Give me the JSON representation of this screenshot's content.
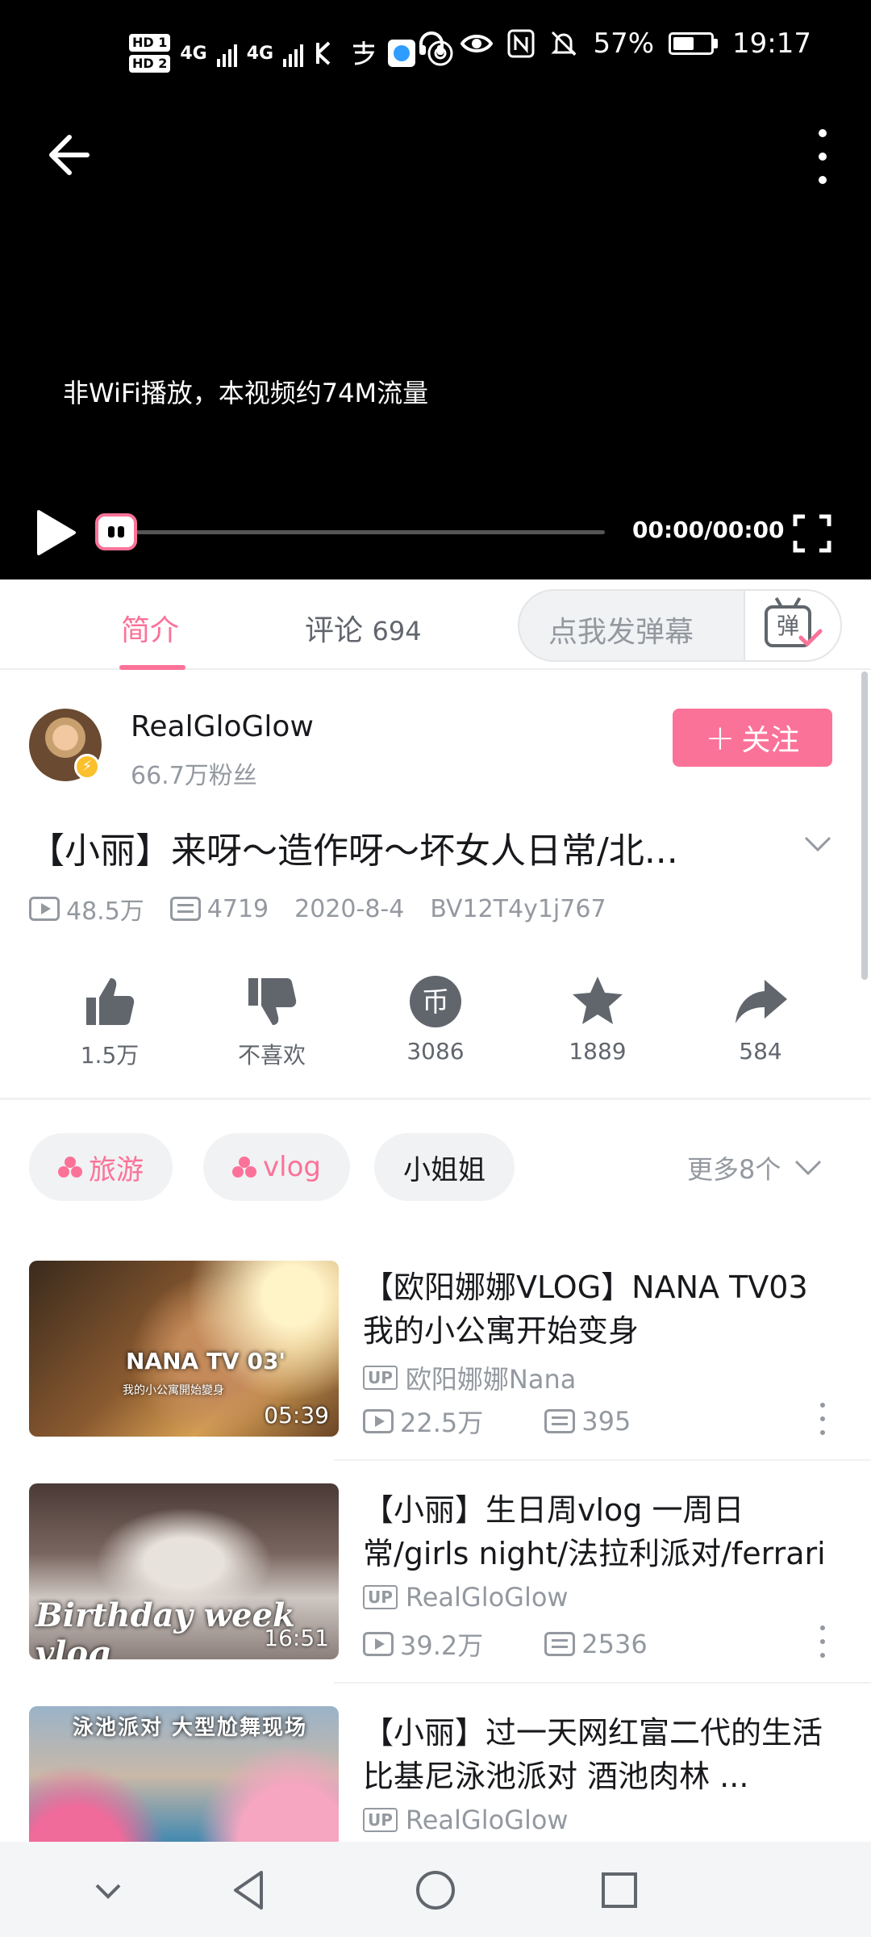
{
  "status_bar": {
    "hd1": "HD 1",
    "hd2": "HD 2",
    "net1": "4G",
    "net2": "4G",
    "battery_percent": "57%",
    "battery_level": 0.57,
    "time": "19:17"
  },
  "player": {
    "flow_notice": "非WiFi播放，本视频约74M流量",
    "time_label": "00:00/00:00",
    "progress": 0
  },
  "tabs": {
    "intro_label": "简介",
    "comments_label": "评论",
    "comments_count": "694",
    "danmaku_placeholder": "点我发弹幕",
    "danmaku_icon_char": "弹"
  },
  "uploader": {
    "name": "RealGloGlow",
    "fans": "66.7万粉丝",
    "follow_label": "关注",
    "follow_plus": "+"
  },
  "video": {
    "title": "【小丽】来呀～造作呀～坏女人日常/北...",
    "views": "48.5万",
    "danmaku": "4719",
    "date": "2020-8-4",
    "bvid": "BV12T4y1j767"
  },
  "actions": [
    {
      "label": "1.5万",
      "icon": "like-icon"
    },
    {
      "label": "不喜欢",
      "icon": "dislike-icon"
    },
    {
      "label": "3086",
      "icon": "coin-icon",
      "coin_char": "币"
    },
    {
      "label": "1889",
      "icon": "star-icon"
    },
    {
      "label": "584",
      "icon": "share-icon"
    }
  ],
  "tags": {
    "items": [
      "旅游",
      "vlog",
      "小姐姐"
    ],
    "more": "更多8个"
  },
  "recommendations": [
    {
      "title": "【欧阳娜娜VLOG】NANA TV03 我的小公寓开始变身",
      "up_badge": "UP",
      "up": "欧阳娜娜Nana",
      "views": "22.5万",
      "danmaku": "395",
      "duration": "05:39",
      "thumb_text": "NANA TV 03'",
      "thumb_sub": "我的小公寓開始變身"
    },
    {
      "title": "【小丽】生日周vlog 一周日常/girls night/法拉利派对/ferrari r...",
      "up_badge": "UP",
      "up": "RealGloGlow",
      "views": "39.2万",
      "danmaku": "2536",
      "duration": "16:51",
      "thumb_text": "Birthday week vlog"
    },
    {
      "title": "【小丽】过一天网红富二代的生活 比基尼泳池派对 酒池肉林 ...",
      "up_badge": "UP",
      "up": "RealGloGlow",
      "thumb_text": "泳池派对 大型尬舞现场"
    }
  ],
  "colors": {
    "accent": "#fb7299",
    "text_primary": "#18191c",
    "text_secondary": "#9499a0"
  }
}
